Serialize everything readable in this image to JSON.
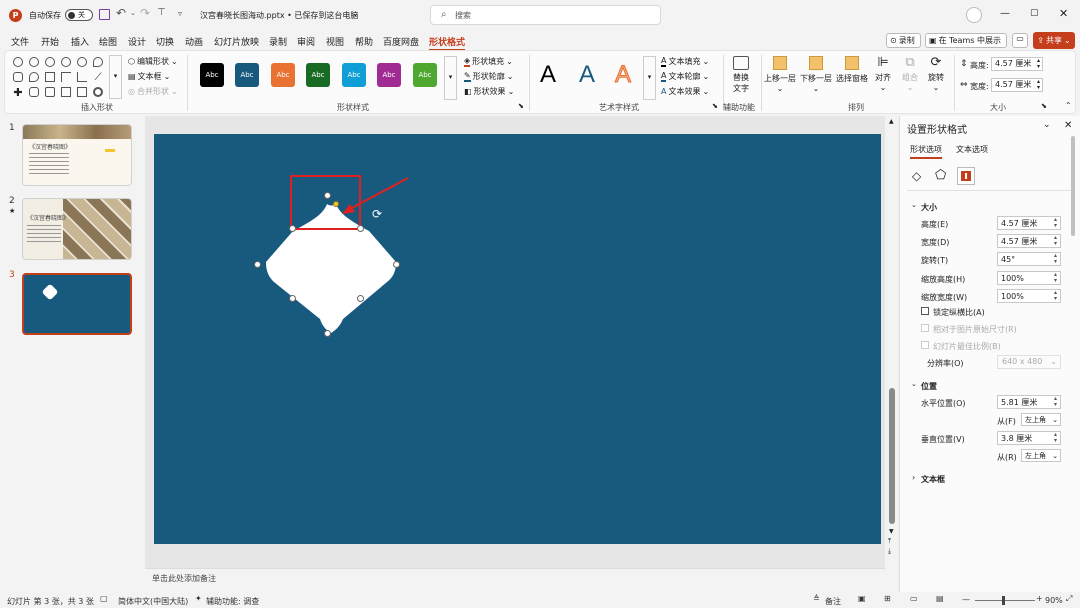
{
  "titlebar": {
    "autosave_label": "自动保存",
    "autosave_state": "关",
    "file_name": "汉宫春晓长图海动.pptx • 已保存到这台电脑",
    "search_placeholder": "搜索"
  },
  "menu": {
    "tabs": [
      "文件",
      "开始",
      "插入",
      "绘图",
      "设计",
      "切换",
      "动画",
      "幻灯片放映",
      "录制",
      "审阅",
      "视图",
      "帮助",
      "百度网盘",
      "形状格式"
    ],
    "active_tab": "形状格式",
    "record_label": "录制",
    "teams_label": "在 Teams 中展示",
    "share_label": "共享"
  },
  "ribbon": {
    "insert_shapes": {
      "edit_shape": "编辑形状",
      "text_box": "文本框",
      "merge_shapes": "合并形状",
      "label": "插入形状"
    },
    "shape_styles": {
      "presets": [
        "Abc",
        "Abc",
        "Abc",
        "Abc",
        "Abc",
        "Abc",
        "Abc"
      ],
      "preset_colors": [
        "#000000",
        "#175a7e",
        "#e97132",
        "#196b24",
        "#0f9ed5",
        "#a02b93",
        "#4ea72e"
      ],
      "fill": "形状填充",
      "outline": "形状轮廓",
      "effects": "形状效果",
      "label": "形状样式"
    },
    "wordart": {
      "letters": [
        "A",
        "A",
        "A"
      ],
      "text_fill": "文本填充",
      "text_outline": "文本轮廓",
      "text_effects": "文本效果",
      "label": "艺术字样式"
    },
    "accessibility": {
      "alt_text_line1": "替换",
      "alt_text_line2": "文字",
      "label": "辅助功能"
    },
    "arrange": {
      "bring_forward": "上移一层",
      "send_backward": "下移一层",
      "selection_pane": "选择窗格",
      "align": "对齐",
      "group": "组合",
      "rotate": "旋转",
      "label": "排列"
    },
    "size": {
      "height_label": "高度:",
      "height_value": "4.57 厘米",
      "width_label": "宽度:",
      "width_value": "4.57 厘米",
      "label": "大小"
    }
  },
  "slides": {
    "numbers": [
      "1",
      "2",
      "3"
    ],
    "slide1_title": "《汉宫春晓图》",
    "slide2_title": "《汉宫春晓图》",
    "active": "3"
  },
  "format_pane": {
    "title": "设置形状格式",
    "tab_shape": "形状选项",
    "tab_text": "文本选项",
    "size_section": "大小",
    "height_label": "高度(E)",
    "height_value": "4.57 厘米",
    "width_label": "宽度(D)",
    "width_value": "4.57 厘米",
    "rotation_label": "旋转(T)",
    "rotation_value": "45°",
    "scale_h_label": "缩放高度(H)",
    "scale_h_value": "100%",
    "scale_w_label": "缩放宽度(W)",
    "scale_w_value": "100%",
    "lock_aspect": "锁定纵横比(A)",
    "relative_original": "相对于图片原始尺寸(R)",
    "best_scale": "幻灯片最佳比例(B)",
    "resolution_label": "分辨率(O)",
    "resolution_value": "640 x 480",
    "position_section": "位置",
    "h_pos_label": "水平位置(O)",
    "h_pos_value": "5.81 厘米",
    "from_f_label": "从(F)",
    "from_f_value": "左上角",
    "v_pos_label": "垂直位置(V)",
    "v_pos_value": "3.8 厘米",
    "from_r_label": "从(R)",
    "from_r_value": "左上角",
    "textbox_section": "文本框"
  },
  "notes_placeholder": "单击此处添加备注",
  "statusbar": {
    "slide_count": "幻灯片 第 3 张，共 3 张",
    "language": "简体中文(中国大陆)",
    "accessibility": "辅助功能: 调查",
    "notes": "备注",
    "zoom": "90%"
  },
  "colors": {
    "accent": "#c43e1c",
    "slide_bg": "#175a7e",
    "highlight_box": "#e02020"
  }
}
